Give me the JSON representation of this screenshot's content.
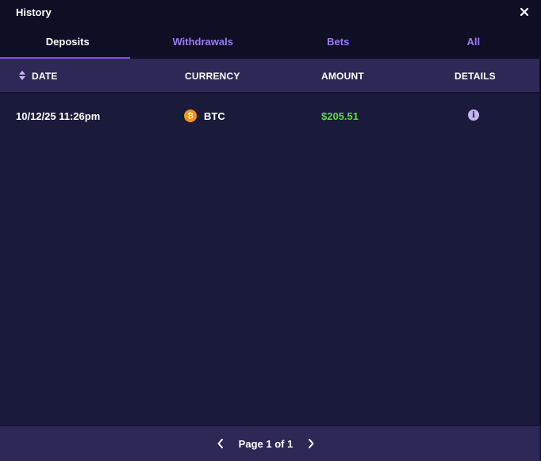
{
  "window": {
    "title": "History"
  },
  "tabs": [
    {
      "label": "Deposits",
      "active": true
    },
    {
      "label": "Withdrawals",
      "active": false
    },
    {
      "label": "Bets",
      "active": false
    },
    {
      "label": "All",
      "active": false
    }
  ],
  "table": {
    "columns": [
      "DATE",
      "CURRENCY",
      "AMOUNT",
      "DETAILS"
    ],
    "rows": [
      {
        "date": "10/12/25 11:26pm",
        "currency": "BTC",
        "amount": "$205.51",
        "details_icon": "info-icon"
      }
    ]
  },
  "pagination": {
    "label": "Page 1 of 1"
  },
  "colors": {
    "background": "#1a1a3a",
    "header_bg": "#0e0e24",
    "row_header_bg": "#2e2856",
    "accent": "#7b4ff0",
    "tab_inactive": "#9b7cf5",
    "amount_positive": "#5fd94a",
    "btc": "#f7931a"
  },
  "icons": {
    "close": "close-icon",
    "sort": "sort-icon",
    "btc": "btc-icon",
    "prev": "chevron-left-icon",
    "next": "chevron-right-icon"
  }
}
